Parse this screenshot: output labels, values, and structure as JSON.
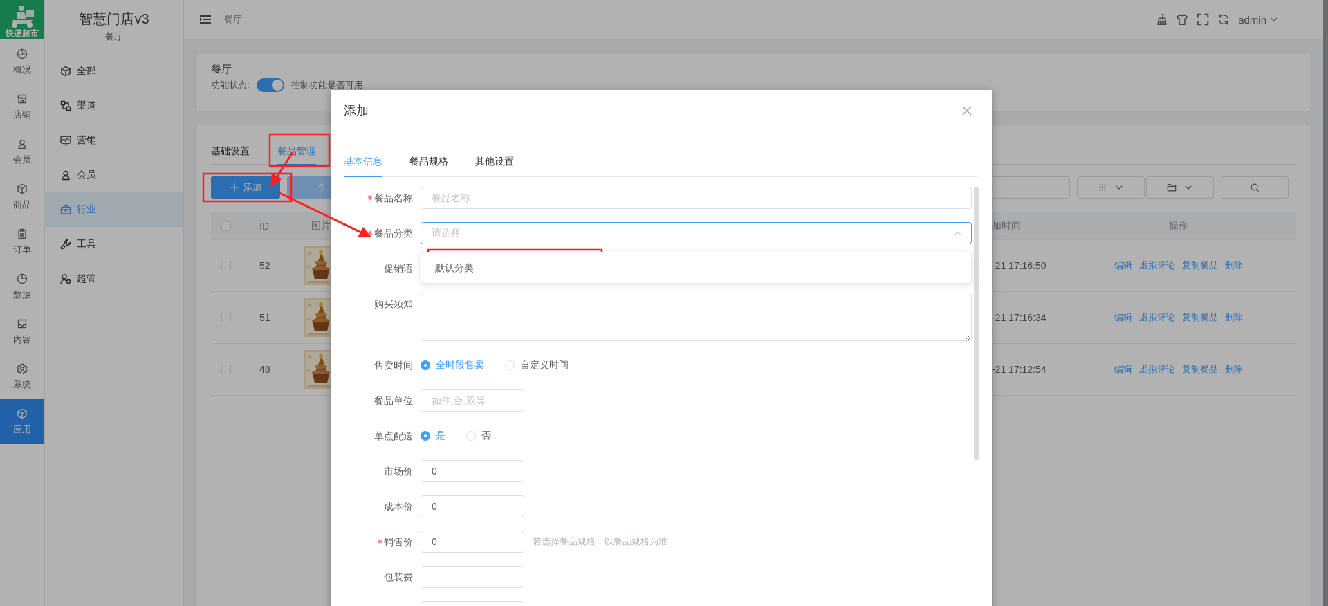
{
  "logo": {
    "text": "快递超市"
  },
  "rail": [
    {
      "label": "概况",
      "selected": false
    },
    {
      "label": "店铺",
      "selected": false
    },
    {
      "label": "会员",
      "selected": false
    },
    {
      "label": "商品",
      "selected": false
    },
    {
      "label": "订单",
      "selected": false
    },
    {
      "label": "数据",
      "selected": false
    },
    {
      "label": "内容",
      "selected": false
    },
    {
      "label": "系统",
      "selected": false
    },
    {
      "label": "应用",
      "selected": true
    }
  ],
  "app": {
    "title": "智慧门店v3",
    "subtitle": "餐厅"
  },
  "sidebar": {
    "items": [
      {
        "label": "全部",
        "selected": false
      },
      {
        "label": "渠道",
        "selected": false
      },
      {
        "label": "营销",
        "selected": false
      },
      {
        "label": "会员",
        "selected": false
      },
      {
        "label": "行业",
        "selected": true
      },
      {
        "label": "工具",
        "selected": false
      },
      {
        "label": "超管",
        "selected": false
      }
    ]
  },
  "header": {
    "breadcrumb": "餐厅",
    "user": "admin"
  },
  "status_card": {
    "title": "餐厅",
    "label": "功能状态:",
    "switch_on": true,
    "description": "控制功能是否可用"
  },
  "tabs": [
    {
      "label": "基础设置",
      "selected": false
    },
    {
      "label": "餐品管理",
      "selected": true
    }
  ],
  "toolbar": {
    "buttons": [
      {
        "label": "添加",
        "kind": "primary"
      },
      {
        "kind": "secondary"
      }
    ]
  },
  "table": {
    "header_checked": false,
    "columns": [
      "ID",
      "图片",
      "加时间",
      "操作"
    ],
    "rows": [
      {
        "checked": false,
        "id": "52",
        "time": "-21 17:16:50",
        "actions": [
          "编辑",
          "虚拟评论",
          "复制餐品",
          "删除"
        ]
      },
      {
        "checked": false,
        "id": "51",
        "time": "-21 17:16:34",
        "actions": [
          "编辑",
          "虚拟评论",
          "复制餐品",
          "删除"
        ]
      },
      {
        "checked": false,
        "id": "48",
        "time": "-21 17:12:54",
        "actions": [
          "编辑",
          "虚拟评论",
          "复制餐品",
          "删除"
        ]
      }
    ]
  },
  "dialog": {
    "title": "添加",
    "tabs": [
      {
        "label": "基本信息",
        "selected": true
      },
      {
        "label": "餐品规格",
        "selected": false
      },
      {
        "label": "其他设置",
        "selected": false
      }
    ],
    "fields": [
      {
        "kind": "input",
        "label": "餐品名称",
        "required": true,
        "placeholder": "餐品名称"
      },
      {
        "kind": "select",
        "label": "餐品分类",
        "required": true,
        "placeholder": "请选择",
        "expanded": true,
        "options": [
          "默认分类"
        ]
      },
      {
        "kind": "input",
        "label": "促销语",
        "required": false
      },
      {
        "kind": "textarea",
        "label": "购买须知",
        "required": false
      },
      {
        "kind": "radio",
        "label": "售卖时间",
        "required": false,
        "options": [
          {
            "label": "全时段售卖",
            "selected": true
          },
          {
            "label": "自定义时间",
            "selected": false
          }
        ]
      },
      {
        "kind": "short_input",
        "label": "餐品单位",
        "required": false,
        "placeholder": "如件,台,双等"
      },
      {
        "kind": "radio",
        "label": "单点配送",
        "required": false,
        "options": [
          {
            "label": "是",
            "selected": true
          },
          {
            "label": "否",
            "selected": false
          }
        ]
      },
      {
        "kind": "short_input",
        "label": "市场价",
        "required": false,
        "value": "0"
      },
      {
        "kind": "short_input",
        "label": "成本价",
        "required": false,
        "value": "0"
      },
      {
        "kind": "short_input",
        "label": "销售价",
        "required": true,
        "value": "0",
        "hint": "若选择餐品规格，以餐品规格为准"
      },
      {
        "kind": "short_input",
        "label": "包装费",
        "required": false
      },
      {
        "kind": "short_input",
        "required": false
      }
    ]
  }
}
